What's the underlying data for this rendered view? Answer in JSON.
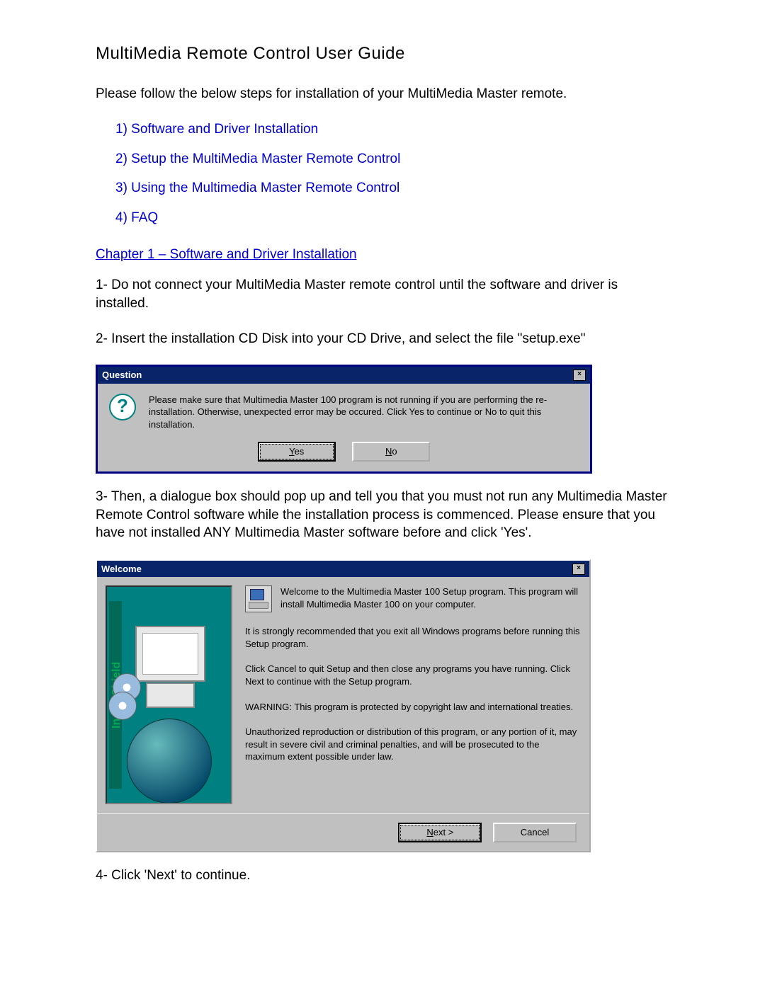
{
  "title": "MultiMedia Remote Control User Guide",
  "intro": "Please follow the below steps for installation of your MultiMedia Master remote.",
  "toc": [
    "1)  Software and Driver Installation",
    "2)  Setup the MultiMedia Master Remote Control",
    "3)  Using the Multimedia Master Remote Control",
    "4)  FAQ"
  ],
  "chapter_heading": "Chapter 1 – Software and Driver Installation",
  "step1": "1- Do not connect your MultiMedia Master remote control until the software and driver is installed.",
  "step2": "2- Insert the installation CD Disk into your CD Drive, and select the file \"setup.exe\"",
  "question_dialog": {
    "title": "Question",
    "close": "×",
    "icon_char": "?",
    "message": "Please make sure that Multimedia Master 100 program is not running if you are performing the re-installation. Otherwise, unexpected error may be occured. Click Yes to continue or No to quit this installation.",
    "yes_u": "Y",
    "yes_rest": "es",
    "no_u": "N",
    "no_rest": "o"
  },
  "step3": "3- Then, a dialogue box should pop up and tell you that you must not run any Multimedia Master Remote Control software while the installation process is commenced. Please ensure that you have not installed ANY Multimedia Master software before and click 'Yes'.",
  "welcome_dialog": {
    "title": "Welcome",
    "close": "×",
    "brand": "InstallShield",
    "p1": "Welcome to the Multimedia Master 100 Setup program.  This program will install Multimedia Master 100 on your computer.",
    "p2": "It is strongly recommended that you exit all Windows programs before running this Setup program.",
    "p3": "Click Cancel to quit Setup and then close any programs you have running.  Click Next to continue with the Setup program.",
    "p4": "WARNING: This program is protected by copyright law and international treaties.",
    "p5": "Unauthorized reproduction or distribution of this program, or any portion of it, may result in severe civil and criminal penalties, and will be prosecuted to the maximum extent possible under law.",
    "next_u": "N",
    "next_rest": "ext >",
    "cancel": "Cancel"
  },
  "step4": "4- Click 'Next' to continue."
}
